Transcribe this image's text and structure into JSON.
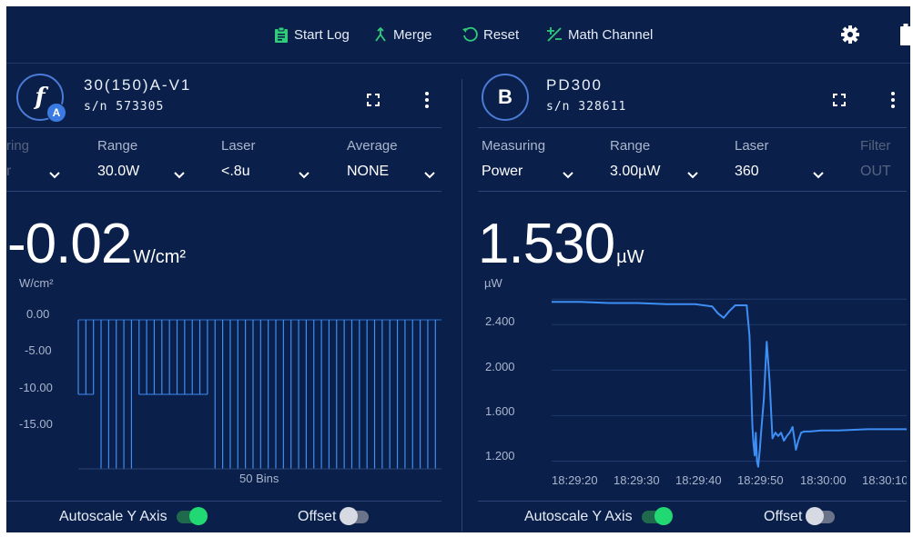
{
  "toolbar": {
    "start_log": "Start Log",
    "merge": "Merge",
    "reset": "Reset",
    "math_channel": "Math Channel"
  },
  "colors": {
    "background": "#0a1f4a",
    "accent_blue": "#3b7ae0",
    "toggle_on": "#22d872",
    "chart_line": "#3d8ef5"
  },
  "panel_a": {
    "badge_letter": "f",
    "badge_sub": "A",
    "device_name": "30(150)A-V1",
    "serial": "s/n 573305",
    "selectors": [
      {
        "label": "ring",
        "value": "r"
      },
      {
        "label": "Range",
        "value": "30.0W"
      },
      {
        "label": "Laser",
        "value": "<.8u"
      },
      {
        "label": "Average",
        "value": "NONE"
      }
    ],
    "reading_value": "-0.02",
    "reading_unit": "W/cm²",
    "axis_unit": "W/cm²",
    "x_caption": "50 Bins",
    "autoscale_label": "Autoscale Y Axis",
    "autoscale_on": true,
    "offset_label": "Offset",
    "offset_on": false
  },
  "panel_b": {
    "badge_letter": "B",
    "device_name": "PD300",
    "serial": "s/n 328611",
    "selectors": [
      {
        "label": "Measuring",
        "value": "Power"
      },
      {
        "label": "Range",
        "value": "3.00µW"
      },
      {
        "label": "Laser",
        "value": "360"
      },
      {
        "label": "Filter",
        "value": "OUT"
      }
    ],
    "reading_value": "1.530",
    "reading_unit": "µW",
    "axis_unit": "µW",
    "autoscale_label": "Autoscale Y Axis",
    "autoscale_on": true,
    "offset_label": "Offset",
    "offset_on": false
  },
  "chart_data": [
    {
      "type": "bar",
      "ylabel": "W/cm²",
      "xlabel": "50 Bins",
      "yticks": [
        "0.00",
        "-5.00",
        "-10.00",
        "-15.00"
      ],
      "ylim": [
        -20,
        0
      ],
      "values": [
        -10,
        -10,
        -10,
        -20,
        -20,
        -20,
        -20,
        -20,
        -10,
        -10,
        -10,
        -10,
        -10,
        -10,
        -10,
        -10,
        -10,
        -10,
        -20,
        -20,
        -20,
        -20,
        -20,
        -20,
        -20,
        -20,
        -20,
        -20,
        -20,
        -20,
        -20,
        -20,
        -20,
        -20,
        -20,
        -20,
        -20,
        -20,
        -20,
        -20,
        -20,
        -20,
        -20,
        -20,
        -20,
        -20,
        -20,
        -20,
        -20,
        -20
      ]
    },
    {
      "type": "line",
      "ylabel": "µW",
      "yticks": [
        "2.400",
        "2.000",
        "1.600",
        "1.200"
      ],
      "ylim": [
        1.1,
        2.65
      ],
      "xticks": [
        "18:29:20",
        "18:29:30",
        "18:29:40",
        "18:29:50",
        "18:30:00",
        "18:30:10"
      ],
      "series": [
        {
          "x": [
            0,
            5,
            10,
            15,
            20,
            25,
            28,
            29,
            30,
            31,
            32,
            33,
            34,
            34.5,
            35,
            35.2,
            35.4,
            35.6,
            35.8,
            36,
            36.3,
            36.6,
            37,
            37.5,
            38,
            38.5,
            39,
            39.5,
            40,
            40.5,
            41,
            41.5,
            42,
            42.3,
            42.6,
            43,
            43.5,
            44,
            45,
            47,
            50,
            55,
            60,
            63
          ],
          "y": [
            2.6,
            2.6,
            2.59,
            2.59,
            2.58,
            2.58,
            2.56,
            2.5,
            2.46,
            2.52,
            2.57,
            2.57,
            2.57,
            2.3,
            1.5,
            1.35,
            1.25,
            1.45,
            1.2,
            1.15,
            1.3,
            1.5,
            1.75,
            2.25,
            1.9,
            1.4,
            1.45,
            1.42,
            1.45,
            1.38,
            1.42,
            1.45,
            1.5,
            1.4,
            1.3,
            1.38,
            1.45,
            1.46,
            1.46,
            1.47,
            1.47,
            1.48,
            1.48,
            1.48
          ]
        }
      ]
    }
  ]
}
